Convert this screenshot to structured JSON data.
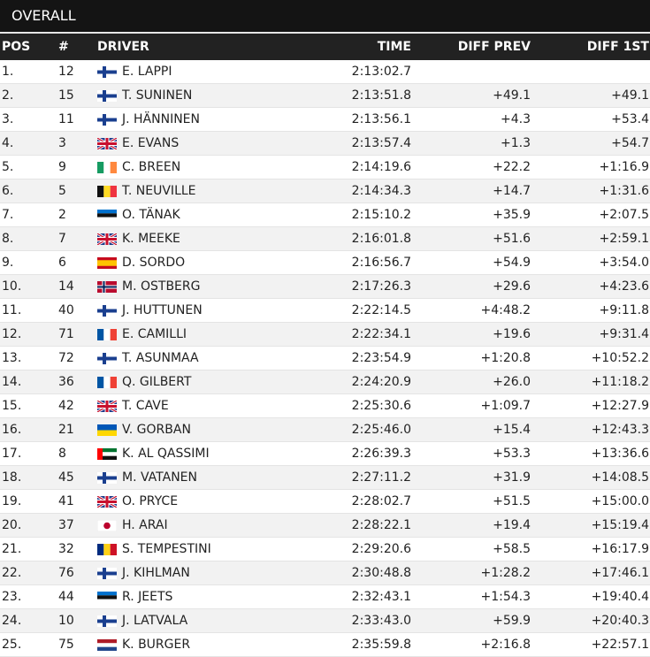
{
  "title": "OVERALL",
  "columns": {
    "pos": "POS",
    "num": "#",
    "driver": "DRIVER",
    "time": "TIME",
    "diff_prev": "DIFF PREV",
    "diff_first": "DIFF 1ST"
  },
  "rows": [
    {
      "pos": "1.",
      "num": "12",
      "flag": "fin-flag",
      "driver": "E. LAPPI",
      "time": "2:13:02.7",
      "diff_prev": "",
      "diff_first": ""
    },
    {
      "pos": "2.",
      "num": "15",
      "flag": "fin-flag",
      "driver": "T. SUNINEN",
      "time": "2:13:51.8",
      "diff_prev": "+49.1",
      "diff_first": "+49.1"
    },
    {
      "pos": "3.",
      "num": "11",
      "flag": "fin-flag",
      "driver": "J. HÄNNINEN",
      "time": "2:13:56.1",
      "diff_prev": "+4.3",
      "diff_first": "+53.4"
    },
    {
      "pos": "4.",
      "num": "3",
      "flag": "gbr-flag",
      "driver": "E. EVANS",
      "time": "2:13:57.4",
      "diff_prev": "+1.3",
      "diff_first": "+54.7"
    },
    {
      "pos": "5.",
      "num": "9",
      "flag": "irl-flag",
      "driver": "C. BREEN",
      "time": "2:14:19.6",
      "diff_prev": "+22.2",
      "diff_first": "+1:16.9"
    },
    {
      "pos": "6.",
      "num": "5",
      "flag": "bel-flag",
      "driver": "T. NEUVILLE",
      "time": "2:14:34.3",
      "diff_prev": "+14.7",
      "diff_first": "+1:31.6"
    },
    {
      "pos": "7.",
      "num": "2",
      "flag": "est-flag",
      "driver": "O. TÄNAK",
      "time": "2:15:10.2",
      "diff_prev": "+35.9",
      "diff_first": "+2:07.5"
    },
    {
      "pos": "8.",
      "num": "7",
      "flag": "gbr-flag",
      "driver": "K. MEEKE",
      "time": "2:16:01.8",
      "diff_prev": "+51.6",
      "diff_first": "+2:59.1"
    },
    {
      "pos": "9.",
      "num": "6",
      "flag": "esp-flag",
      "driver": "D. SORDO",
      "time": "2:16:56.7",
      "diff_prev": "+54.9",
      "diff_first": "+3:54.0"
    },
    {
      "pos": "10.",
      "num": "14",
      "flag": "nor-flag",
      "driver": "M. OSTBERG",
      "time": "2:17:26.3",
      "diff_prev": "+29.6",
      "diff_first": "+4:23.6"
    },
    {
      "pos": "11.",
      "num": "40",
      "flag": "fin-flag",
      "driver": "J. HUTTUNEN",
      "time": "2:22:14.5",
      "diff_prev": "+4:48.2",
      "diff_first": "+9:11.8"
    },
    {
      "pos": "12.",
      "num": "71",
      "flag": "fra-flag",
      "driver": "E. CAMILLI",
      "time": "2:22:34.1",
      "diff_prev": "+19.6",
      "diff_first": "+9:31.4"
    },
    {
      "pos": "13.",
      "num": "72",
      "flag": "fin-flag",
      "driver": "T. ASUNMAA",
      "time": "2:23:54.9",
      "diff_prev": "+1:20.8",
      "diff_first": "+10:52.2"
    },
    {
      "pos": "14.",
      "num": "36",
      "flag": "fra-flag",
      "driver": "Q. GILBERT",
      "time": "2:24:20.9",
      "diff_prev": "+26.0",
      "diff_first": "+11:18.2"
    },
    {
      "pos": "15.",
      "num": "42",
      "flag": "gbr-flag",
      "driver": "T. CAVE",
      "time": "2:25:30.6",
      "diff_prev": "+1:09.7",
      "diff_first": "+12:27.9"
    },
    {
      "pos": "16.",
      "num": "21",
      "flag": "ukr-flag",
      "driver": "V. GORBAN",
      "time": "2:25:46.0",
      "diff_prev": "+15.4",
      "diff_first": "+12:43.3"
    },
    {
      "pos": "17.",
      "num": "8",
      "flag": "uae-flag",
      "driver": "K. AL QASSIMI",
      "time": "2:26:39.3",
      "diff_prev": "+53.3",
      "diff_first": "+13:36.6"
    },
    {
      "pos": "18.",
      "num": "45",
      "flag": "fin-flag",
      "driver": "M. VATANEN",
      "time": "2:27:11.2",
      "diff_prev": "+31.9",
      "diff_first": "+14:08.5"
    },
    {
      "pos": "19.",
      "num": "41",
      "flag": "gbr-flag",
      "driver": "O. PRYCE",
      "time": "2:28:02.7",
      "diff_prev": "+51.5",
      "diff_first": "+15:00.0"
    },
    {
      "pos": "20.",
      "num": "37",
      "flag": "jpn-flag",
      "driver": "H. ARAI",
      "time": "2:28:22.1",
      "diff_prev": "+19.4",
      "diff_first": "+15:19.4"
    },
    {
      "pos": "21.",
      "num": "32",
      "flag": "rou-flag",
      "driver": "S. TEMPESTINI",
      "time": "2:29:20.6",
      "diff_prev": "+58.5",
      "diff_first": "+16:17.9"
    },
    {
      "pos": "22.",
      "num": "76",
      "flag": "fin-flag",
      "driver": "J. KIHLMAN",
      "time": "2:30:48.8",
      "diff_prev": "+1:28.2",
      "diff_first": "+17:46.1"
    },
    {
      "pos": "23.",
      "num": "44",
      "flag": "est-flag",
      "driver": "R. JEETS",
      "time": "2:32:43.1",
      "diff_prev": "+1:54.3",
      "diff_first": "+19:40.4"
    },
    {
      "pos": "24.",
      "num": "10",
      "flag": "fin-flag",
      "driver": "J. LATVALA",
      "time": "2:33:43.0",
      "diff_prev": "+59.9",
      "diff_first": "+20:40.3"
    },
    {
      "pos": "25.",
      "num": "75",
      "flag": "ned-flag",
      "driver": "K. BURGER",
      "time": "2:35:59.8",
      "diff_prev": "+2:16.8",
      "diff_first": "+22:57.1"
    }
  ]
}
